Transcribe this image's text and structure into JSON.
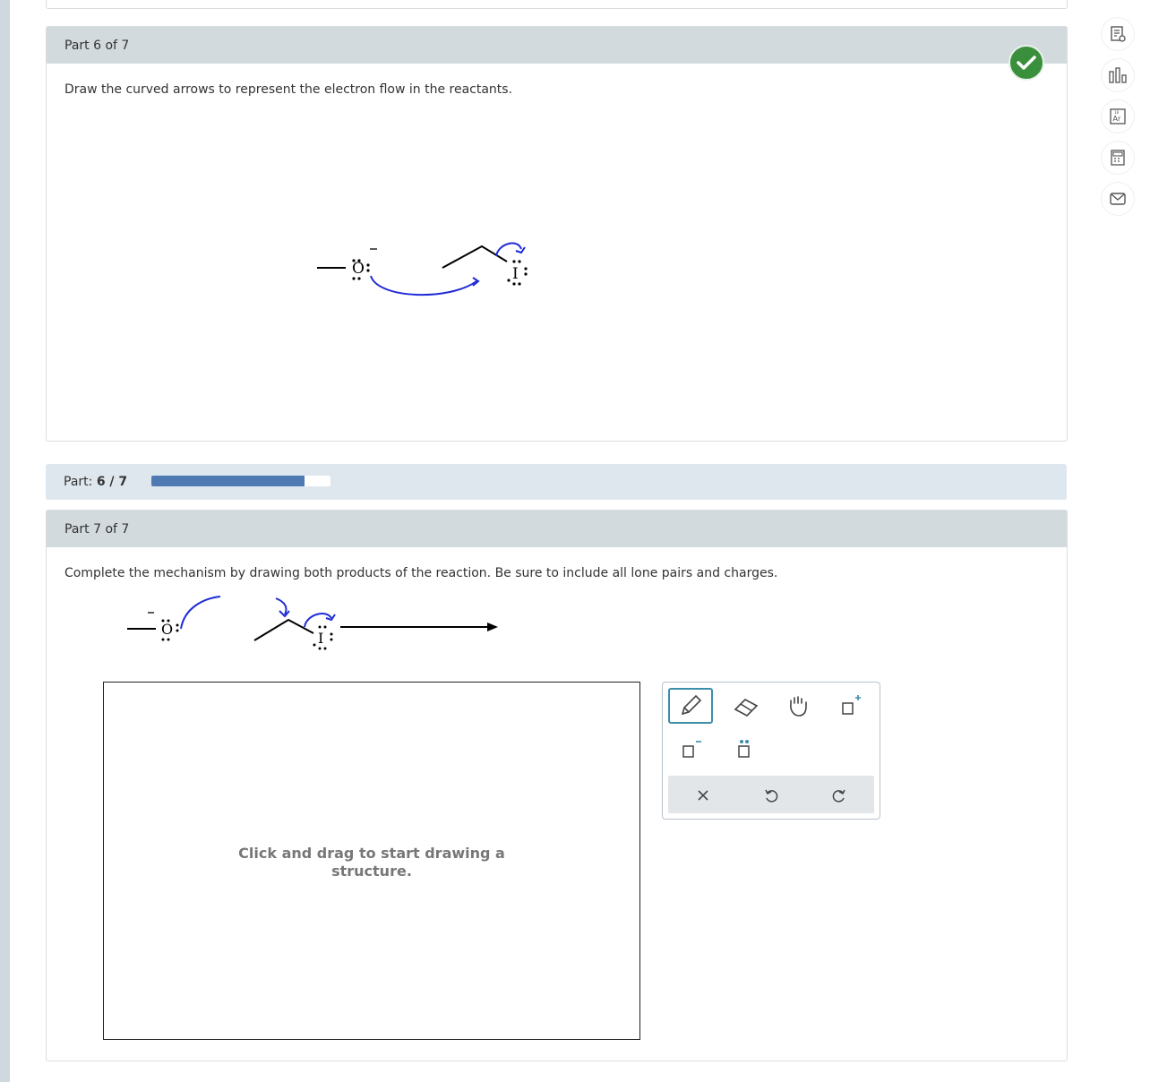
{
  "part6": {
    "header": "Part 6 of 7",
    "prompt": "Draw the curved arrows to represent the electron flow in the reactants.",
    "status": "correct"
  },
  "progress": {
    "label_prefix": "Part:",
    "label_value": "6 / 7",
    "fraction": 0.857
  },
  "part7": {
    "header": "Part 7 of 7",
    "prompt": "Complete the mechanism by drawing both products of the reaction. Be sure to include all lone pairs and charges.",
    "draw_hint": "Click and drag to start drawing a structure."
  },
  "molecule": {
    "oxygen_symbol": "O",
    "iodine_symbol": "I",
    "charge_symbol": "−"
  },
  "toolbar": {
    "tools": [
      {
        "name": "pencil-icon",
        "selected": true
      },
      {
        "name": "eraser-icon",
        "selected": false
      },
      {
        "name": "hand-icon",
        "selected": false
      },
      {
        "name": "positive-charge-icon",
        "selected": false
      },
      {
        "name": "negative-charge-icon",
        "selected": false
      },
      {
        "name": "lone-pair-icon",
        "selected": false
      }
    ],
    "actions": [
      "clear-icon",
      "undo-icon",
      "redo-icon"
    ]
  },
  "sidebar_icons": [
    "explanation-icon",
    "chart-icon",
    "periodic-table-icon",
    "calculator-icon",
    "mail-icon"
  ],
  "colors": {
    "arrow": "#1f2bd6",
    "check": "#3a8f3c",
    "progress": "#4e79b3",
    "accent": "#3d8eaa"
  }
}
